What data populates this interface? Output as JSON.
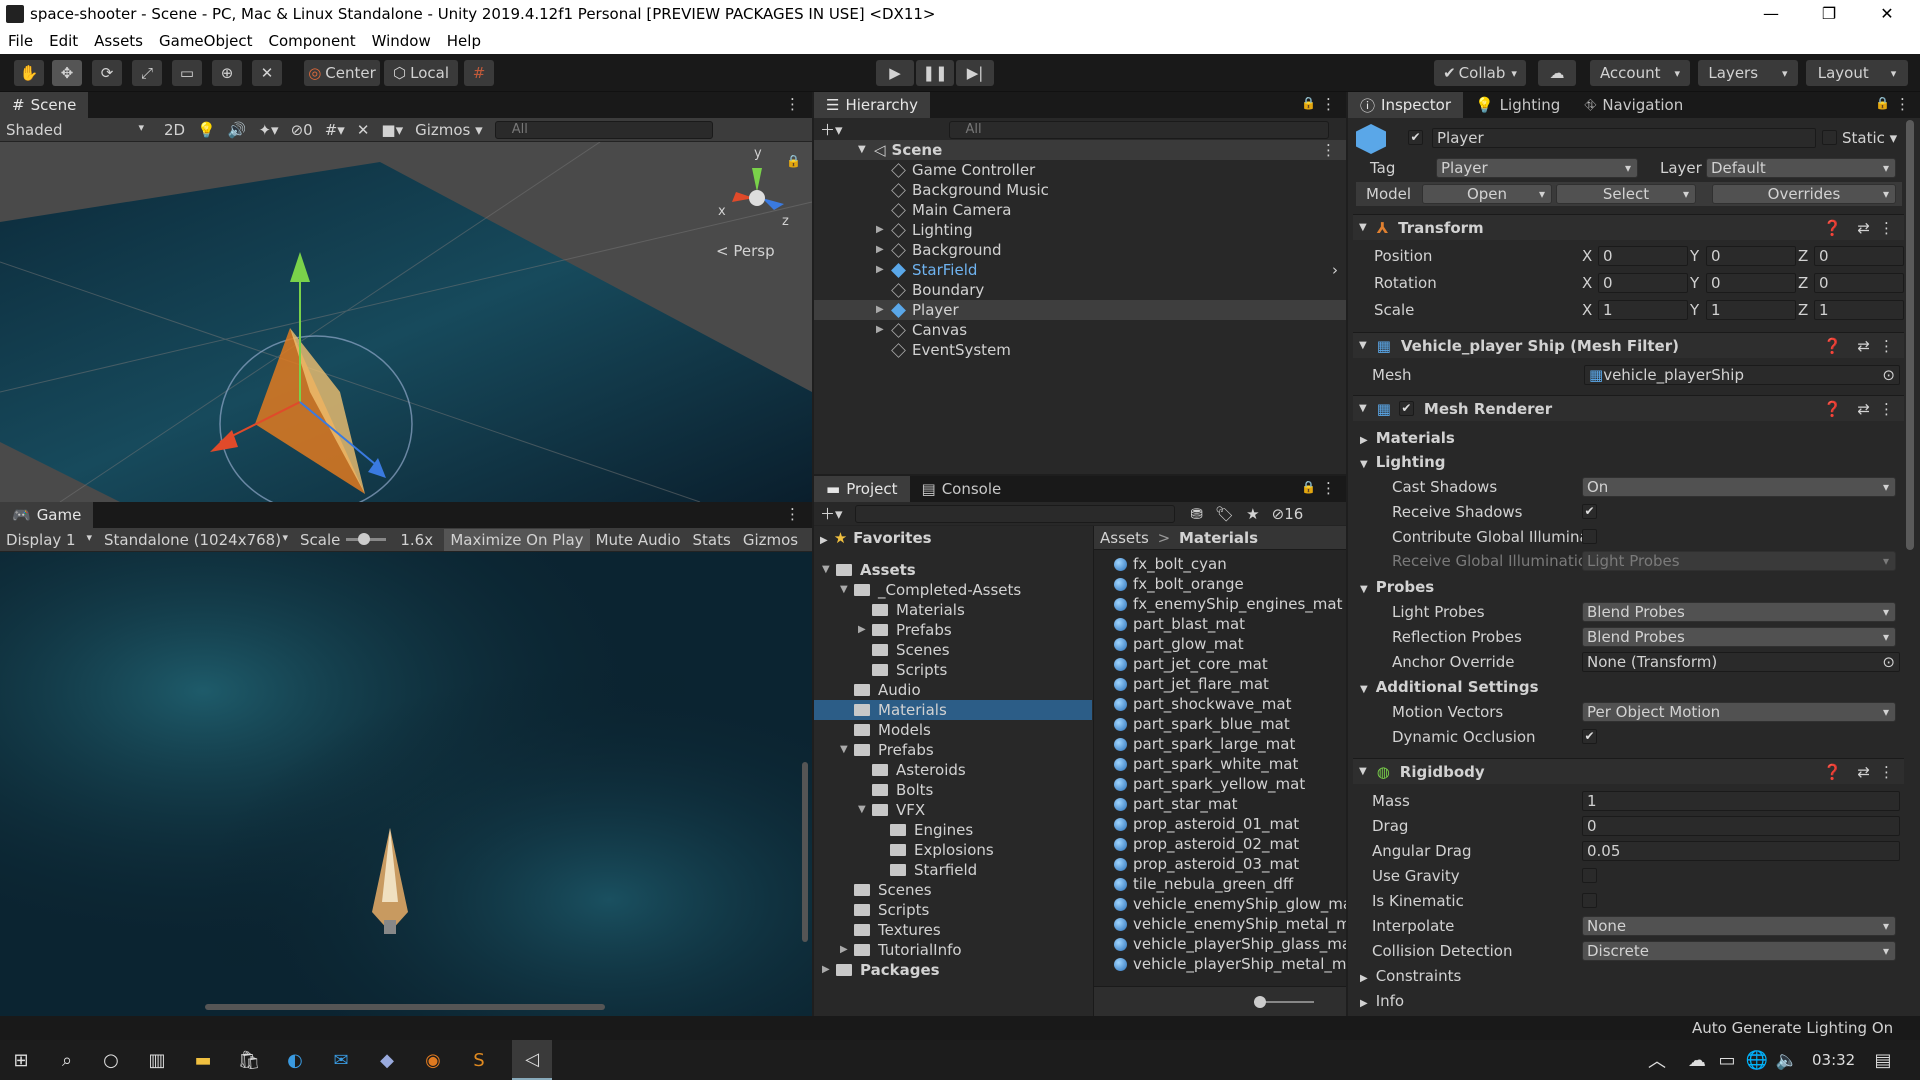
{
  "window": {
    "title": "space-shooter - Scene - PC, Mac & Linux Standalone - Unity 2019.4.12f1 Personal [PREVIEW PACKAGES IN USE] <DX11>",
    "min": "—",
    "max": "❐",
    "close": "✕"
  },
  "menu": [
    "File",
    "Edit",
    "Assets",
    "GameObject",
    "Component",
    "Window",
    "Help"
  ],
  "toolbar": {
    "center_label": "Center",
    "local_label": "Local",
    "collab_label": "Collab",
    "account_label": "Account",
    "layers_label": "Layers",
    "layout_label": "Layout"
  },
  "scene_panel": {
    "tab": "Scene",
    "shading": "Shaded",
    "mode_2d": "2D",
    "hidden_count": "0",
    "gizmos": "Gizmos",
    "search_placeholder": "All",
    "persp": "Persp",
    "axis_x": "x",
    "axis_y": "y",
    "axis_z": "z"
  },
  "game_panel": {
    "tab": "Game",
    "display": "Display 1",
    "resolution": "Standalone (1024x768)",
    "scale_label": "Scale",
    "scale_value": "1.6x",
    "maximize": "Maximize On Play",
    "mute": "Mute Audio",
    "stats": "Stats",
    "gizmos": "Gizmos"
  },
  "hierarchy": {
    "tab": "Hierarchy",
    "search_placeholder": "All",
    "scene": "Scene",
    "items": [
      {
        "name": "Game Controller",
        "arrow": false,
        "style": "normal"
      },
      {
        "name": "Background Music",
        "arrow": false,
        "style": "normal"
      },
      {
        "name": "Main Camera",
        "arrow": false,
        "style": "normal"
      },
      {
        "name": "Lighting",
        "arrow": true,
        "style": "normal"
      },
      {
        "name": "Background",
        "arrow": true,
        "style": "normal"
      },
      {
        "name": "StarField",
        "arrow": true,
        "style": "prefab"
      },
      {
        "name": "Boundary",
        "arrow": false,
        "style": "normal"
      },
      {
        "name": "Player",
        "arrow": true,
        "style": "selected"
      },
      {
        "name": "Canvas",
        "arrow": true,
        "style": "normal"
      },
      {
        "name": "EventSystem",
        "arrow": false,
        "style": "normal"
      }
    ]
  },
  "project": {
    "tab_project": "Project",
    "tab_console": "Console",
    "hidden_count": "16",
    "favorites": "Favorites",
    "tree": [
      {
        "name": "Assets",
        "depth": 0,
        "arrow": "down",
        "bold": true
      },
      {
        "name": "_Completed-Assets",
        "depth": 1,
        "arrow": "down"
      },
      {
        "name": "Materials",
        "depth": 2,
        "arrow": ""
      },
      {
        "name": "Prefabs",
        "depth": 2,
        "arrow": "right"
      },
      {
        "name": "Scenes",
        "depth": 2,
        "arrow": ""
      },
      {
        "name": "Scripts",
        "depth": 2,
        "arrow": ""
      },
      {
        "name": "Audio",
        "depth": 1,
        "arrow": ""
      },
      {
        "name": "Materials",
        "depth": 1,
        "arrow": "",
        "selected": true
      },
      {
        "name": "Models",
        "depth": 1,
        "arrow": ""
      },
      {
        "name": "Prefabs",
        "depth": 1,
        "arrow": "down"
      },
      {
        "name": "Asteroids",
        "depth": 2,
        "arrow": ""
      },
      {
        "name": "Bolts",
        "depth": 2,
        "arrow": ""
      },
      {
        "name": "VFX",
        "depth": 2,
        "arrow": "down"
      },
      {
        "name": "Engines",
        "depth": 3,
        "arrow": ""
      },
      {
        "name": "Explosions",
        "depth": 3,
        "arrow": ""
      },
      {
        "name": "Starfield",
        "depth": 3,
        "arrow": ""
      },
      {
        "name": "Scenes",
        "depth": 1,
        "arrow": ""
      },
      {
        "name": "Scripts",
        "depth": 1,
        "arrow": ""
      },
      {
        "name": "Textures",
        "depth": 1,
        "arrow": ""
      },
      {
        "name": "TutorialInfo",
        "depth": 1,
        "arrow": "right"
      },
      {
        "name": "Packages",
        "depth": 0,
        "arrow": "right",
        "bold": true
      }
    ],
    "breadcrumb_root": "Assets",
    "breadcrumb_sep": ">",
    "breadcrumb_current": "Materials",
    "files": [
      "fx_bolt_cyan",
      "fx_bolt_orange",
      "fx_enemyShip_engines_mat",
      "part_blast_mat",
      "part_glow_mat",
      "part_jet_core_mat",
      "part_jet_flare_mat",
      "part_shockwave_mat",
      "part_spark_blue_mat",
      "part_spark_large_mat",
      "part_spark_white_mat",
      "part_spark_yellow_mat",
      "part_star_mat",
      "prop_asteroid_01_mat",
      "prop_asteroid_02_mat",
      "prop_asteroid_03_mat",
      "tile_nebula_green_dff",
      "vehicle_enemyShip_glow_mat",
      "vehicle_enemyShip_metal_ma",
      "vehicle_playerShip_glass_mat",
      "vehicle_playerShip_metal_mat"
    ]
  },
  "inspector": {
    "tab_inspector": "Inspector",
    "tab_lighting": "Lighting",
    "tab_navigation": "Navigation",
    "object_name": "Player",
    "static_label": "Static",
    "tag_label": "Tag",
    "tag_value": "Player",
    "layer_label": "Layer",
    "layer_value": "Default",
    "model_label": "Model",
    "open_btn": "Open",
    "select_btn": "Select",
    "overrides": "Overrides",
    "transform": {
      "title": "Transform",
      "rows": [
        {
          "label": "Position",
          "x": "0",
          "y": "0",
          "z": "0"
        },
        {
          "label": "Rotation",
          "x": "0",
          "y": "0",
          "z": "0"
        },
        {
          "label": "Scale",
          "x": "1",
          "y": "1",
          "z": "1"
        }
      ],
      "x": "X",
      "y": "Y",
      "z": "Z"
    },
    "mesh_filter": {
      "title": "Vehicle_player Ship (Mesh Filter)",
      "mesh_label": "Mesh",
      "mesh_value": "vehicle_playerShip"
    },
    "mesh_renderer": {
      "title": "Mesh Renderer",
      "materials": "Materials",
      "lighting": "Lighting",
      "cast_shadows_label": "Cast Shadows",
      "cast_shadows": "On",
      "receive_shadows_label": "Receive Shadows",
      "contribute_gi_label": "Contribute Global Illuminat",
      "receive_gi_label": "Receive Global Illuminatio",
      "receive_gi": "Light Probes",
      "probes": "Probes",
      "light_probes_label": "Light Probes",
      "light_probes": "Blend Probes",
      "reflection_probes_label": "Reflection Probes",
      "reflection_probes": "Blend Probes",
      "anchor_label": "Anchor Override",
      "anchor": "None (Transform)",
      "additional": "Additional Settings",
      "motion_label": "Motion Vectors",
      "motion": "Per Object Motion",
      "dynamic_occ_label": "Dynamic Occlusion"
    },
    "rigidbody": {
      "title": "Rigidbody",
      "mass_label": "Mass",
      "mass": "1",
      "drag_label": "Drag",
      "drag": "0",
      "angular_label": "Angular Drag",
      "angular": "0.05",
      "gravity_label": "Use Gravity",
      "kinematic_label": "Is Kinematic",
      "interpolate_label": "Interpolate",
      "interpolate": "None",
      "collision_label": "Collision Detection",
      "collision": "Discrete",
      "constraints": "Constraints",
      "info": "Info"
    }
  },
  "status": {
    "text": "Auto Generate Lighting On"
  },
  "taskbar": {
    "time": "03:32"
  }
}
